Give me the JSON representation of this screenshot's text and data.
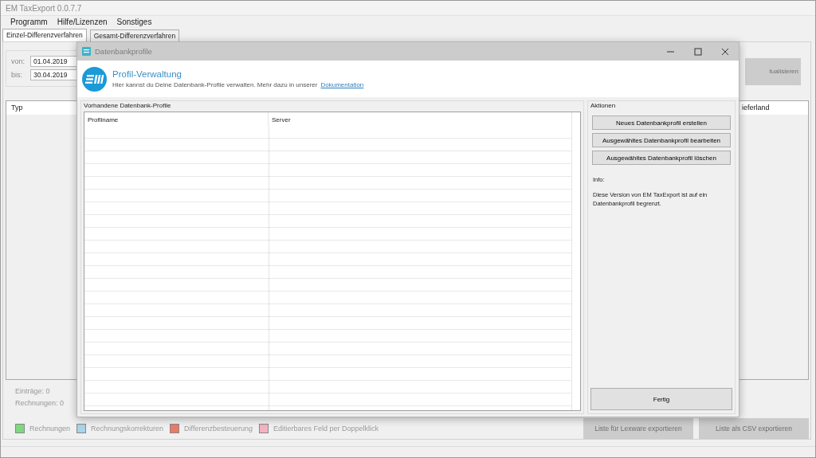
{
  "main_window": {
    "title": "EM TaxExport 0.0.7.7",
    "menu": [
      "Programm",
      "Hilfe/Lizenzen",
      "Sonstiges"
    ],
    "tabs": [
      {
        "label": "Einzel-Differenzverfahren",
        "selected": true
      },
      {
        "label": "Gesamt-Differenzverfahren",
        "selected": false
      }
    ],
    "date_filter": [
      {
        "label": "von:",
        "value": "01.04.2019"
      },
      {
        "label": "bis:",
        "value": "30.04.2019"
      }
    ],
    "refresh_button": {
      "label": "tualisieren",
      "disabled": true
    },
    "table": {
      "columns": [
        "Typ",
        "ieferland"
      ]
    },
    "summary": [
      "Einträge: 0",
      "Rechnungen: 0"
    ],
    "legend": [
      {
        "label": "Rechnungen",
        "color": "#7fd87f"
      },
      {
        "label": "Rechnungskorrekturen",
        "color": "#a9d3e6"
      },
      {
        "label": "Differenzbesteuerung",
        "color": "#ec7b66"
      },
      {
        "label": "Editierbares Feld per Doppelklick",
        "color": "#f4b2c1"
      }
    ],
    "export_buttons": [
      {
        "label": "Liste für Lexware exportieren",
        "disabled": true
      },
      {
        "label": "Liste als CSV exportieren",
        "disabled": true
      }
    ]
  },
  "dialog": {
    "title": "Datenbankprofile",
    "header": {
      "title": "Profil-Verwaltung",
      "description": "Hier kannst du Deine Datenbank-Profile verwalten. Mehr dazu in unserer",
      "link": "Dokumentation"
    },
    "profiles": {
      "title": "Vorhandene Datenbank-Profile",
      "columns": [
        "Profilname",
        "Server"
      ]
    },
    "actions": {
      "title": "Aktionen",
      "buttons": [
        "Neues Datenbankprofil erstellen",
        "Ausgewähltes Datenbankprofil bearbeiten",
        "Ausgewähltes Datenbankprofil löschen"
      ],
      "info_label": "Info:",
      "info_text": "Diese Version von EM TaxExport ist auf ein Datenbankprofil begrenzt."
    },
    "done_button": "Fertig"
  }
}
